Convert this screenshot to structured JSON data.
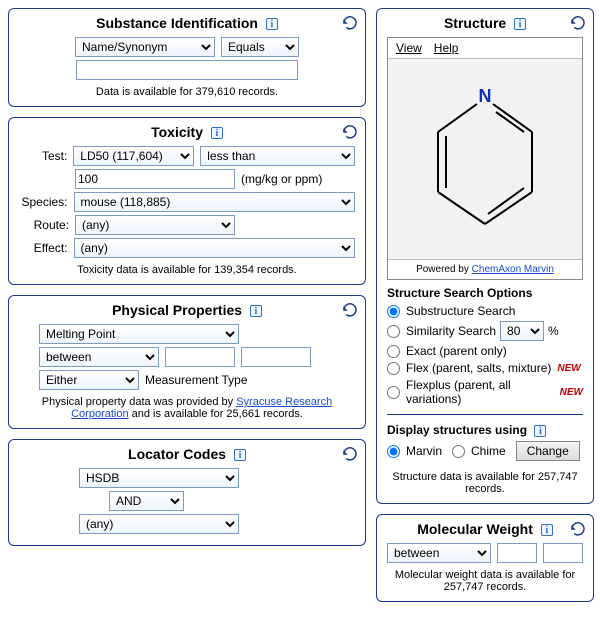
{
  "substance": {
    "title": "Substance Identification",
    "field_select": "Name/Synonym",
    "op_select": "Equals",
    "value": "",
    "footnote": "Data is available for 379,610 records."
  },
  "toxicity": {
    "title": "Toxicity",
    "labels": {
      "test": "Test:",
      "species": "Species:",
      "route": "Route:",
      "effect": "Effect:"
    },
    "test_select": "LD50 (117,604)",
    "test_op": "less than",
    "test_value": "100",
    "units": "(mg/kg or ppm)",
    "species_select": "mouse (118,885)",
    "route_select": "(any)",
    "effect_select": "(any)",
    "footnote": "Toxicity data is available for 139,354 records."
  },
  "physprop": {
    "title": "Physical Properties",
    "prop_select": "Melting Point",
    "op_select": "between",
    "lo": "",
    "hi": "",
    "mt_select": "Either",
    "mt_label": "Measurement Type",
    "foot_pre": "Physical property data was provided by ",
    "foot_link": "Syracuse Research Corporation",
    "foot_post": " and is available for 25,661 records."
  },
  "locator": {
    "title": "Locator Codes",
    "src_select": "HSDB",
    "bool_select": "AND",
    "src2_select": "(any)"
  },
  "structure": {
    "title": "Structure",
    "menu": {
      "view": "View",
      "help": "Help"
    },
    "powered_pre": "Powered by ",
    "powered_link": "ChemAxon Marvin",
    "atom_label": "N",
    "opts_head": "Structure Search Options",
    "opts": {
      "sub": "Substructure Search",
      "sim": "Similarity Search",
      "sim_val": "80",
      "sim_pct": "%",
      "exact": "Exact (parent only)",
      "flex": "Flex (parent, salts, mixture)",
      "flexplus": "Flexplus (parent, all variations)",
      "new": "NEW"
    },
    "disp_head": "Display structures using",
    "disp": {
      "marvin": "Marvin",
      "chime": "Chime",
      "change": "Change"
    },
    "footnote": "Structure data is available for 257,747 records."
  },
  "mw": {
    "title": "Molecular Weight",
    "op_select": "between",
    "lo": "",
    "hi": "",
    "footnote": "Molecular weight data is available for 257,747 records."
  }
}
